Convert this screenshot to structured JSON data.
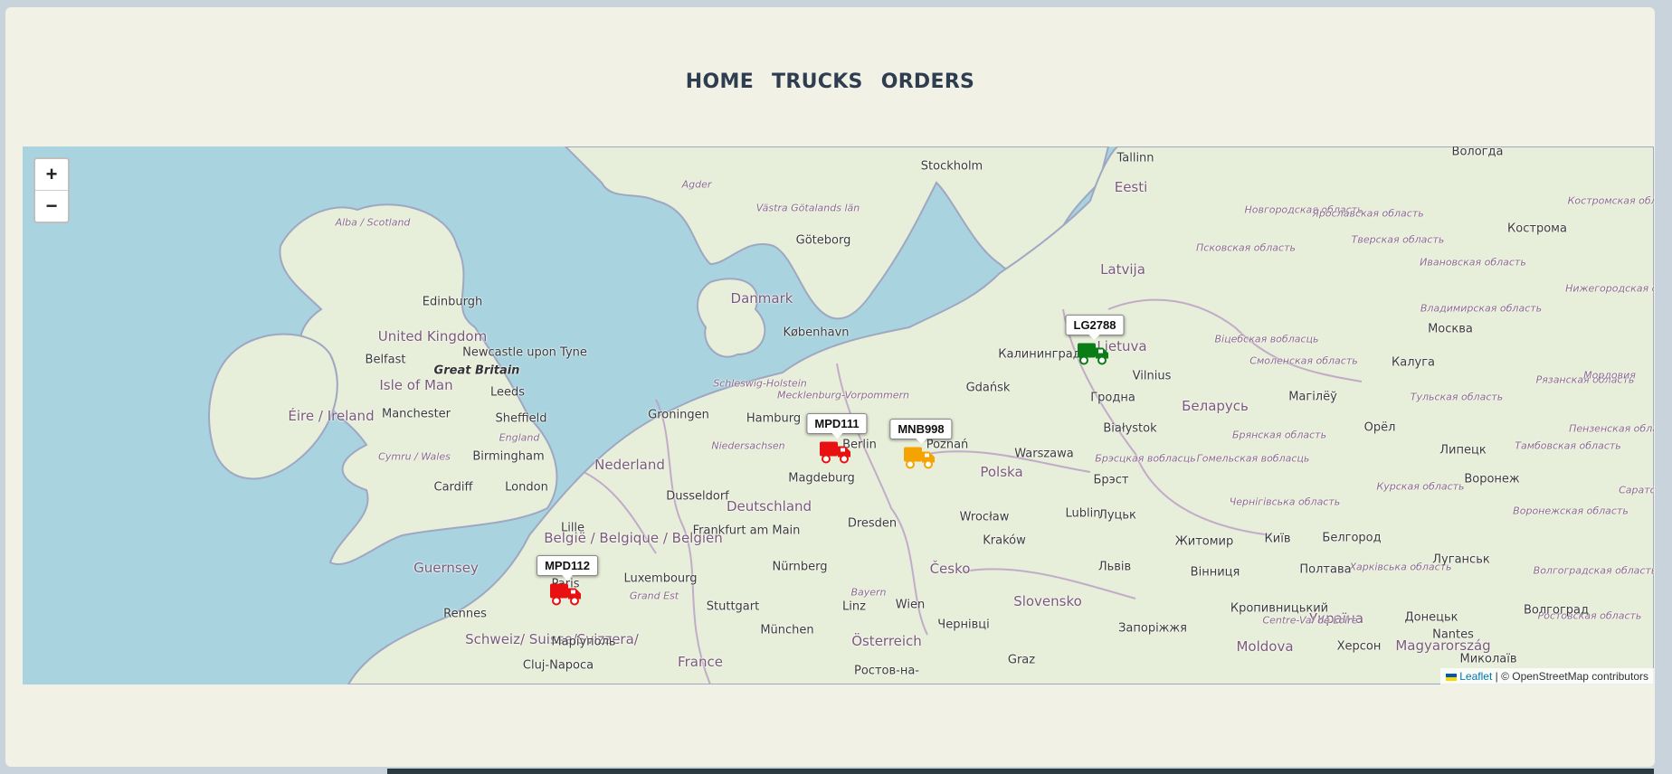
{
  "nav": {
    "items": [
      "HOME",
      "TRUCKS",
      "ORDERS"
    ]
  },
  "map": {
    "zoom_in": "+",
    "zoom_out": "−",
    "attribution": {
      "leaflet": "Leaflet",
      "rest": " | © OpenStreetMap contributors"
    },
    "trucks": [
      {
        "id": "LG2788",
        "color": "#0a7d16"
      },
      {
        "id": "MPD111",
        "color": "#e81010"
      },
      {
        "id": "MNB998",
        "color": "#f5a300"
      },
      {
        "id": "MPD112",
        "color": "#e81010"
      }
    ],
    "labels": [
      {
        "text": "Stockholm",
        "cls": ""
      },
      {
        "text": "Tallinn",
        "cls": ""
      },
      {
        "text": "Вологда",
        "cls": ""
      },
      {
        "text": "Eesti",
        "cls": "country"
      },
      {
        "text": "Agder",
        "cls": "region"
      },
      {
        "text": "Västra Götalands län",
        "cls": "region"
      },
      {
        "text": "Göteborg",
        "cls": ""
      },
      {
        "text": "Alba / Scotland",
        "cls": "region"
      },
      {
        "text": "Edinburgh",
        "cls": ""
      },
      {
        "text": "United Kingdom",
        "cls": "country"
      },
      {
        "text": "Newcastle upon Tyne",
        "cls": ""
      },
      {
        "text": "Belfast",
        "cls": ""
      },
      {
        "text": "Great Britain",
        "cls": "bold"
      },
      {
        "text": "Isle of Man",
        "cls": "country"
      },
      {
        "text": "Leeds",
        "cls": ""
      },
      {
        "text": "Manchester",
        "cls": ""
      },
      {
        "text": "Sheffield",
        "cls": ""
      },
      {
        "text": "Éire / Ireland",
        "cls": "country"
      },
      {
        "text": "England",
        "cls": "region"
      },
      {
        "text": "Cymru / Wales",
        "cls": "region"
      },
      {
        "text": "Birmingham",
        "cls": ""
      },
      {
        "text": "Cardiff",
        "cls": ""
      },
      {
        "text": "London",
        "cls": ""
      },
      {
        "text": "Danmark",
        "cls": "country"
      },
      {
        "text": "København",
        "cls": ""
      },
      {
        "text": "Latvija",
        "cls": "country"
      },
      {
        "text": "Калининград",
        "cls": ""
      },
      {
        "text": "Lietuva",
        "cls": "country"
      },
      {
        "text": "Vilnius",
        "cls": ""
      },
      {
        "text": "Москва",
        "cls": ""
      },
      {
        "text": "Кострома",
        "cls": ""
      },
      {
        "text": "Калуга",
        "cls": ""
      },
      {
        "text": "Смоленская область",
        "cls": "region"
      },
      {
        "text": "Псковская область",
        "cls": "region"
      },
      {
        "text": "Новгородская область",
        "cls": "region"
      },
      {
        "text": "Тверская область",
        "cls": "region"
      },
      {
        "text": "Ярославская область",
        "cls": "region"
      },
      {
        "text": "Костромская область",
        "cls": "region"
      },
      {
        "text": "Ивановская область",
        "cls": "region"
      },
      {
        "text": "Нижегородская область",
        "cls": "region"
      },
      {
        "text": "Владимирская область",
        "cls": "region"
      },
      {
        "text": "Рязанская область",
        "cls": "region"
      },
      {
        "text": "Мордовия",
        "cls": "region"
      },
      {
        "text": "Тульская область",
        "cls": "region"
      },
      {
        "text": "Віцебская вобласць",
        "cls": "region"
      },
      {
        "text": "Schleswig-Holstein",
        "cls": "region"
      },
      {
        "text": "Mecklenburg-Vorpommern",
        "cls": "region"
      },
      {
        "text": "Gdańsk",
        "cls": ""
      },
      {
        "text": "Гродна",
        "cls": ""
      },
      {
        "text": "Беларусь",
        "cls": "country"
      },
      {
        "text": "Магілёў",
        "cls": ""
      },
      {
        "text": "Groningen",
        "cls": ""
      },
      {
        "text": "Hamburg",
        "cls": ""
      },
      {
        "text": "Niedersachsen",
        "cls": "region"
      },
      {
        "text": "Berlin",
        "cls": ""
      },
      {
        "text": "Białystok",
        "cls": ""
      },
      {
        "text": "Орёл",
        "cls": ""
      },
      {
        "text": "Липецк",
        "cls": ""
      },
      {
        "text": "Брянская область",
        "cls": "region"
      },
      {
        "text": "Тамбовская область",
        "cls": "region"
      },
      {
        "text": "Пензенская область",
        "cls": "region"
      },
      {
        "text": "Nederland",
        "cls": "country"
      },
      {
        "text": "Magdeburg",
        "cls": ""
      },
      {
        "text": "Poznań",
        "cls": ""
      },
      {
        "text": "Warszawa",
        "cls": ""
      },
      {
        "text": "Polska",
        "cls": "country"
      },
      {
        "text": "Брэсцкая вобласць",
        "cls": "region"
      },
      {
        "text": "Гомельская вобласць",
        "cls": "region"
      },
      {
        "text": "Курская область",
        "cls": "region"
      },
      {
        "text": "Воронеж",
        "cls": ""
      },
      {
        "text": "Брэст",
        "cls": ""
      },
      {
        "text": "Dusseldorf",
        "cls": ""
      },
      {
        "text": "Deutschland",
        "cls": "country"
      },
      {
        "text": "Чернігівська область",
        "cls": "region"
      },
      {
        "text": "Воронежская область",
        "cls": "region"
      },
      {
        "text": "Саратов",
        "cls": "region"
      },
      {
        "text": "Lille",
        "cls": ""
      },
      {
        "text": "België / Belgique / Belgien",
        "cls": "country"
      },
      {
        "text": "Frankfurt am Main",
        "cls": ""
      },
      {
        "text": "Dresden",
        "cls": ""
      },
      {
        "text": "Wrocław",
        "cls": ""
      },
      {
        "text": "Lublin",
        "cls": ""
      },
      {
        "text": "Луцьк",
        "cls": ""
      },
      {
        "text": "Kraków",
        "cls": ""
      },
      {
        "text": "Житомир",
        "cls": ""
      },
      {
        "text": "Київ",
        "cls": ""
      },
      {
        "text": "Белгород",
        "cls": ""
      },
      {
        "text": "Харківська область",
        "cls": "region"
      },
      {
        "text": "Волгоградская область",
        "cls": "region"
      },
      {
        "text": "Guernsey",
        "cls": "country"
      },
      {
        "text": "Luxembourg",
        "cls": ""
      },
      {
        "text": "Nürnberg",
        "cls": ""
      },
      {
        "text": "Česko",
        "cls": "country"
      },
      {
        "text": "Львів",
        "cls": ""
      },
      {
        "text": "Вінниця",
        "cls": ""
      },
      {
        "text": "Полтава",
        "cls": ""
      },
      {
        "text": "Луганськ",
        "cls": ""
      },
      {
        "text": "Paris",
        "cls": ""
      },
      {
        "text": "Grand Est",
        "cls": "region"
      },
      {
        "text": "Bayern",
        "cls": "region"
      },
      {
        "text": "Stuttgart",
        "cls": ""
      },
      {
        "text": "Linz",
        "cls": ""
      },
      {
        "text": "Wien",
        "cls": ""
      },
      {
        "text": "Slovensko",
        "cls": "country"
      },
      {
        "text": "Кропивницький",
        "cls": ""
      },
      {
        "text": "Україна",
        "cls": "country"
      },
      {
        "text": "Донецьк",
        "cls": ""
      },
      {
        "text": "Ростовская область",
        "cls": "region"
      },
      {
        "text": "Волгоград",
        "cls": ""
      },
      {
        "text": "Rennes",
        "cls": ""
      },
      {
        "text": "München",
        "cls": ""
      },
      {
        "text": "Österreich",
        "cls": "country"
      },
      {
        "text": "Чернівці",
        "cls": ""
      },
      {
        "text": "Запоріжжя",
        "cls": ""
      },
      {
        "text": "Centre-Val de Loire",
        "cls": "region"
      },
      {
        "text": "Nantes",
        "cls": ""
      },
      {
        "text": "Schweiz/ Suisse/Svizzera/",
        "cls": "country"
      },
      {
        "text": "Magyarország",
        "cls": "country"
      },
      {
        "text": "Миколаїв",
        "cls": ""
      },
      {
        "text": "Маріуполь",
        "cls": ""
      },
      {
        "text": "France",
        "cls": "country"
      },
      {
        "text": "Graz",
        "cls": ""
      },
      {
        "text": "Moldova",
        "cls": "country"
      },
      {
        "text": "Херсон",
        "cls": ""
      },
      {
        "text": "Cluj-Napoca",
        "cls": ""
      },
      {
        "text": "Ростов-на-",
        "cls": ""
      }
    ]
  }
}
